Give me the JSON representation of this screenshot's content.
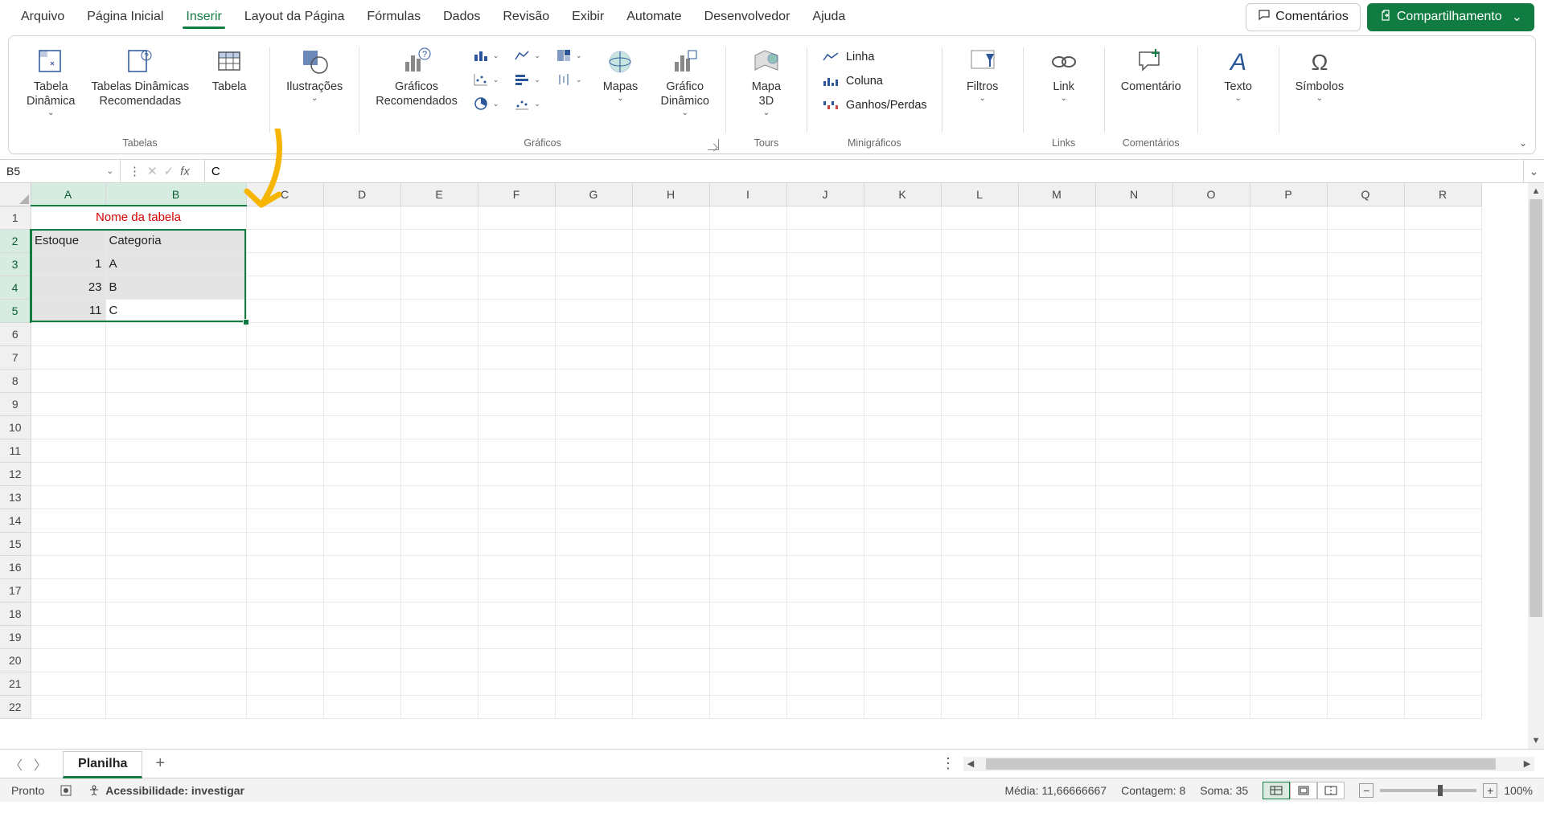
{
  "menu": {
    "tabs": [
      "Arquivo",
      "Página Inicial",
      "Inserir",
      "Layout da Página",
      "Fórmulas",
      "Dados",
      "Revisão",
      "Exibir",
      "Automate",
      "Desenvolvedor",
      "Ajuda"
    ],
    "active_index": 2,
    "comments": "Comentários",
    "share": "Compartilhamento"
  },
  "ribbon": {
    "groups": {
      "tables": {
        "label": "Tabelas",
        "pivot": "Tabela\nDinâmica",
        "recpivot": "Tabelas Dinâmicas\nRecomendadas",
        "table": "Tabela"
      },
      "illustr": {
        "btn": "Ilustrações"
      },
      "charts": {
        "label": "Gráficos",
        "rec": "Gráficos\nRecomendados",
        "maps": "Mapas",
        "pivotchart": "Gráfico\nDinâmico"
      },
      "tours": {
        "label": "Tours",
        "map3d": "Mapa\n3D"
      },
      "spark": {
        "label": "Minigráficos",
        "line": "Linha",
        "col": "Coluna",
        "winloss": "Ganhos/Perdas"
      },
      "filters": {
        "btn": "Filtros"
      },
      "links": {
        "label": "Links",
        "btn": "Link"
      },
      "comments": {
        "label": "Comentários",
        "btn": "Comentário"
      },
      "text": {
        "btn": "Texto"
      },
      "symbols": {
        "btn": "Símbolos"
      }
    }
  },
  "fbar": {
    "name": "B5",
    "formula": "C"
  },
  "columns": [
    "A",
    "B",
    "C",
    "D",
    "E",
    "F",
    "G",
    "H",
    "I",
    "J",
    "K",
    "L",
    "M",
    "N",
    "O",
    "P",
    "Q",
    "R"
  ],
  "rows": 22,
  "sheet": {
    "A1": "Nome da tabela",
    "A2": "Estoque",
    "B2": "Categoria",
    "A3": "1",
    "B3": "A",
    "A4": "23",
    "B4": "B",
    "A5": "11",
    "B5": "C"
  },
  "tabbar": {
    "sheet": "Planilha"
  },
  "status": {
    "ready": "Pronto",
    "access": "Acessibilidade: investigar",
    "avg": "Média: 11,66666667",
    "count": "Contagem: 8",
    "sum": "Soma: 35",
    "zoom": "100%"
  }
}
